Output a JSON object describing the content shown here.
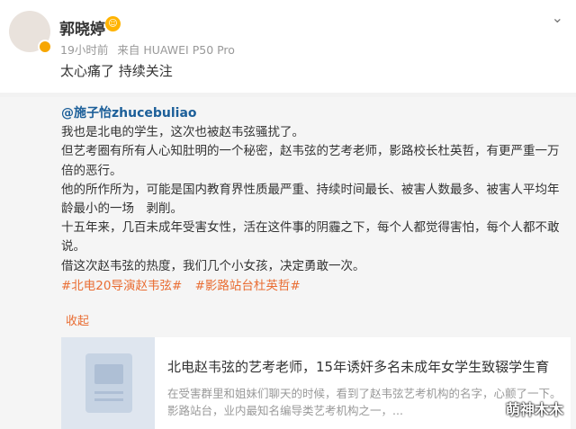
{
  "post": {
    "username": "郭晓婷",
    "time": "19小时前",
    "source": "来自 HUAWEI P50 Pro",
    "text": "太心痛了 持续关注"
  },
  "repost": {
    "author": "@施子怡zhucebuliao",
    "lines": [
      "我也是北电的学生，这次也被赵韦弦骚扰了。",
      "但艺考圈有所有人心知肚明的一个秘密，赵韦弦的艺考老师，影路校长杜英哲，有更严重一万倍的恶行。",
      "他的所作所为，可能是国内教育界性质最严重、持续时间最长、被害人数最多、被害人平均年龄最小的一场　剥削。",
      "十五年来，几百未成年受害女性，活在这件事的阴霾之下，每个人都觉得害怕，每个人都不敢说。",
      "借这次赵韦弦的热度，我们几个小女孩，决定勇敢一次。"
    ],
    "tags": [
      "#北电20导演赵韦弦#",
      "#影路站台杜英哲#"
    ],
    "collapse": "收起"
  },
  "link_card": {
    "title": "北电赵韦弦的艺考老师，15年诱奸多名未成年女学生致辍学生育",
    "desc": "在受害群里和姐妹们聊天的时候，看到了赵韦弦艺考机构的名字，心颤了一下。 影路站台，业内最知名编导类艺考机构之一，..."
  },
  "watermark": "萌神木木"
}
